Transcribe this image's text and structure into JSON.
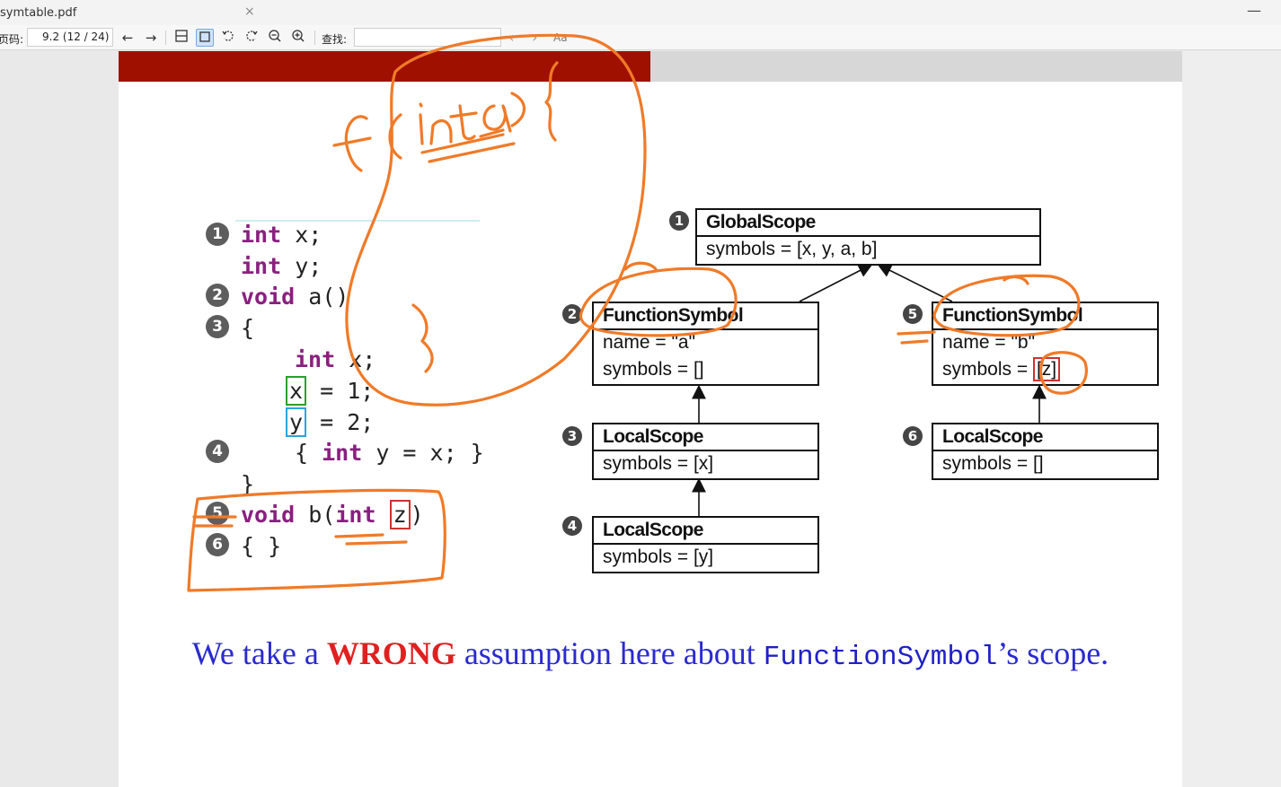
{
  "window": {
    "tab_title": "symtable.pdf",
    "close_glyph": "×",
    "minimize_glyph": "—"
  },
  "toolbar": {
    "page_label": "页码:",
    "page_value": "9.2  (12 / 24)",
    "back_glyph": "←",
    "forward_glyph": "→",
    "find_label": "查找:",
    "find_value": "",
    "find_prev_glyph": "‹",
    "find_next_glyph": "›",
    "match_case_label": "Aa",
    "icons": [
      "single-page-view-icon",
      "fit-page-icon",
      "rotate-left-icon",
      "rotate-right-icon",
      "zoom-out-icon",
      "zoom-in-icon"
    ]
  },
  "slide": {
    "code_lines": [
      {
        "num": "1",
        "kw": "int",
        "rest": " x;"
      },
      {
        "num": "",
        "kw": "int",
        "rest": " y;"
      },
      {
        "num": "2",
        "kw": "void",
        "rest": " a()"
      },
      {
        "num": "3",
        "kw": "",
        "rest": "{"
      },
      {
        "num": "",
        "kw": "int",
        "rest": " x;"
      },
      {
        "num": "",
        "boxed": "x",
        "rest": " = 1;"
      },
      {
        "num": "",
        "boxed": "y",
        "rest": " = 2;"
      },
      {
        "num": "4",
        "pre": "{ ",
        "kw": "int",
        "rest": " y = x; }"
      },
      {
        "num": "",
        "kw": "",
        "rest": "}"
      },
      {
        "num": "5",
        "kw": "void",
        "rest": " b(",
        "kw2": "int",
        "boxed": "z",
        "tail": ")"
      },
      {
        "num": "6",
        "kw": "",
        "rest": "{ }"
      }
    ],
    "code": {
      "l1_kw": "int",
      "l1_rest": " x;",
      "l2_kw": "int",
      "l2_rest": " y;",
      "l3_kw": "void",
      "l3_rest": " a()",
      "l4_rest": "{",
      "l5_kw": "int",
      "l5_rest": " x;",
      "l6_box": "x",
      "l6_rest": " = 1;",
      "l7_box": "y",
      "l7_rest": " = 2;",
      "l8_pre": "{ ",
      "l8_kw": "int",
      "l8_rest": " y = x; }",
      "l9_rest": "}",
      "l10_kw": "void",
      "l10_rest": " b(",
      "l10_kw2": "int",
      "l10_box": "z",
      "l10_tail": ")",
      "l11_rest": "{ }"
    },
    "line_numbers": [
      "1",
      "2",
      "3",
      "4",
      "5",
      "6"
    ],
    "diagram": {
      "global": {
        "num": "1",
        "title": "GlobalScope",
        "symbols": "symbols = [x, y, a, b]"
      },
      "func_a": {
        "num": "2",
        "title": "FunctionSymbol",
        "name": "name = \"a\"",
        "symbols": "symbols = []"
      },
      "local_a1": {
        "num": "3",
        "title": "LocalScope",
        "symbols": "symbols = [x]"
      },
      "local_a2": {
        "num": "4",
        "title": "LocalScope",
        "symbols": "symbols = [y]"
      },
      "func_b": {
        "num": "5",
        "title": "FunctionSymbol",
        "name": "name = \"b\"",
        "symbols_pre": "symbols = ",
        "symbols_val": "[z]"
      },
      "local_b": {
        "num": "6",
        "title": "LocalScope",
        "symbols": "symbols = []"
      }
    },
    "caption": {
      "part1": "We take a ",
      "wrong": "WRONG",
      "part2": " assumption here about ",
      "mono": "FunctionSymbol",
      "part3": "’s scope."
    },
    "annotation_color": "#f07a28",
    "header_color": "#a01000"
  }
}
